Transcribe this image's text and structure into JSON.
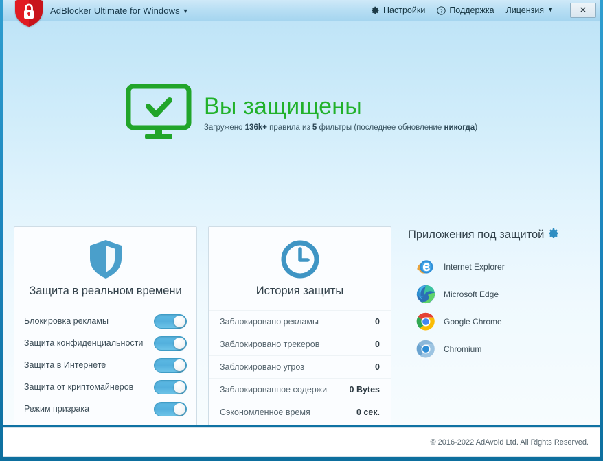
{
  "window": {
    "title": "AdBlocker Ultimate for Windows",
    "title_caret": "▼",
    "logo_icon": "red-shield-lock-icon",
    "close_label": "✕"
  },
  "menu": {
    "items": [
      {
        "label": "Настройки",
        "icon": "gear-icon",
        "caret": ""
      },
      {
        "label": "Поддержка",
        "icon": "question-circle-icon",
        "caret": ""
      },
      {
        "label": "Лицензия",
        "icon": "",
        "caret": "▼"
      }
    ]
  },
  "hero": {
    "icon": "monitor-check-icon",
    "title": "Вы защищены",
    "status_prefix": "Загружено ",
    "rules_count": "136k+",
    "status_mid": " правила из ",
    "filters_count": "5",
    "status_mid2": " фильтры (последнее обновление ",
    "last_update": "никогда",
    "status_suffix": ")"
  },
  "protection_card": {
    "icon": "shield-icon",
    "title": "Защита в реальном времени",
    "toggles": [
      {
        "label": "Блокировка рекламы",
        "state": "on"
      },
      {
        "label": "Защита конфиденциальности",
        "state": "on"
      },
      {
        "label": "Защита в Интернете",
        "state": "on"
      },
      {
        "label": "Защита от криптомайнеров",
        "state": "on"
      },
      {
        "label": "Режим призрака",
        "state": "on"
      }
    ]
  },
  "history_card": {
    "icon": "clock-icon",
    "title": "История защиты",
    "stats": [
      {
        "label": "Заблокировано рекламы",
        "value": "0"
      },
      {
        "label": "Заблокировано трекеров",
        "value": "0"
      },
      {
        "label": "Заблокировано угроз",
        "value": "0"
      },
      {
        "label": "Заблокированное содержи",
        "value": "0 Bytes"
      },
      {
        "label": "Сэкономленное время",
        "value": "0 сек."
      }
    ]
  },
  "apps_panel": {
    "title": "Приложения под защитой",
    "gear_icon": "gear-icon",
    "apps": [
      {
        "name": "Internet Explorer",
        "icon": "internet-explorer-icon"
      },
      {
        "name": "Microsoft Edge",
        "icon": "microsoft-edge-icon"
      },
      {
        "name": "Google Chrome",
        "icon": "google-chrome-icon"
      },
      {
        "name": "Chromium",
        "icon": "chromium-icon"
      }
    ]
  },
  "footer": {
    "copyright": "© 2016-2022 AdAvoid Ltd. All Rights Reserved."
  },
  "colors": {
    "accent_green": "#21b12a",
    "accent_blue": "#4a9fcb",
    "brand_red": "#e11b22"
  }
}
